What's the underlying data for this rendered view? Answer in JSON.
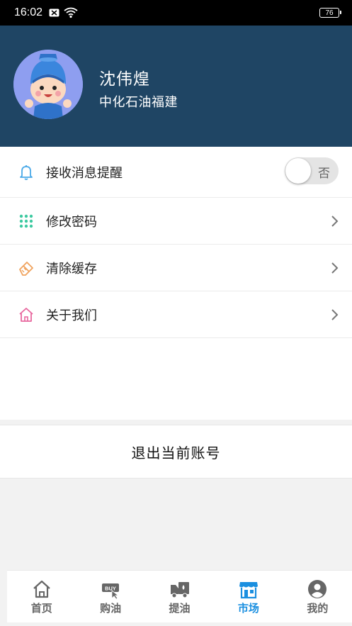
{
  "status_bar": {
    "time": "16:02",
    "battery": "76"
  },
  "profile": {
    "name": "沈伟煌",
    "company": "中化石油福建"
  },
  "settings": {
    "items": [
      {
        "label": "接收消息提醒",
        "icon": "bell-icon",
        "toggle_text": "否",
        "toggle_on": false
      },
      {
        "label": "修改密码",
        "icon": "keypad-icon"
      },
      {
        "label": "清除缓存",
        "icon": "eraser-icon"
      },
      {
        "label": "关于我们",
        "icon": "home-icon"
      }
    ]
  },
  "logout_label": "退出当前账号",
  "nav": {
    "items": [
      {
        "label": "首页",
        "icon": "home-icon"
      },
      {
        "label": "购油",
        "icon": "buy-icon"
      },
      {
        "label": "提油",
        "icon": "truck-icon"
      },
      {
        "label": "市场",
        "icon": "store-icon",
        "active": true
      },
      {
        "label": "我的",
        "icon": "user-icon"
      }
    ]
  },
  "colors": {
    "header_bg": "#1f4564",
    "active_nav": "#1a8fe0",
    "bell_icon": "#4aa9e8",
    "keypad_icon": "#3cc9a0",
    "eraser_icon": "#f0a35e",
    "about_icon": "#e8679e"
  }
}
